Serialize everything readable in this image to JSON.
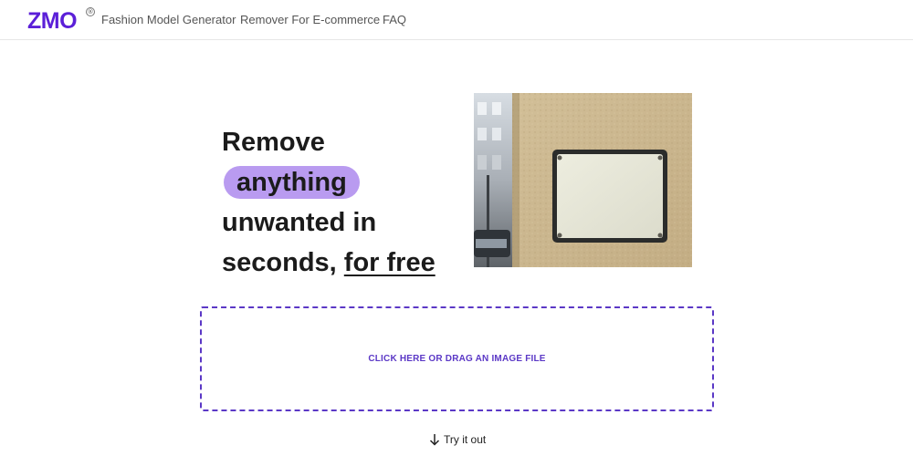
{
  "header": {
    "logo_text": "ZMO",
    "logo_mark": "®",
    "nav": [
      "Fashion Model Generator",
      "Remover For E-commerce",
      "FAQ"
    ]
  },
  "hero": {
    "headline_start": "Remove",
    "headline_highlight": "anything",
    "headline_line2": "unwanted in",
    "headline_line3_start": "seconds, ",
    "headline_underlined": "for free"
  },
  "upload": {
    "label": "CLICK HERE OR DRAG AN IMAGE FILE"
  },
  "cta": {
    "label": "Try it out",
    "icon": "arrow-down-icon"
  },
  "colors": {
    "brand": "#5b1fd8",
    "accent_pill": "#b99bf0",
    "dropzone": "#5b38c6"
  }
}
